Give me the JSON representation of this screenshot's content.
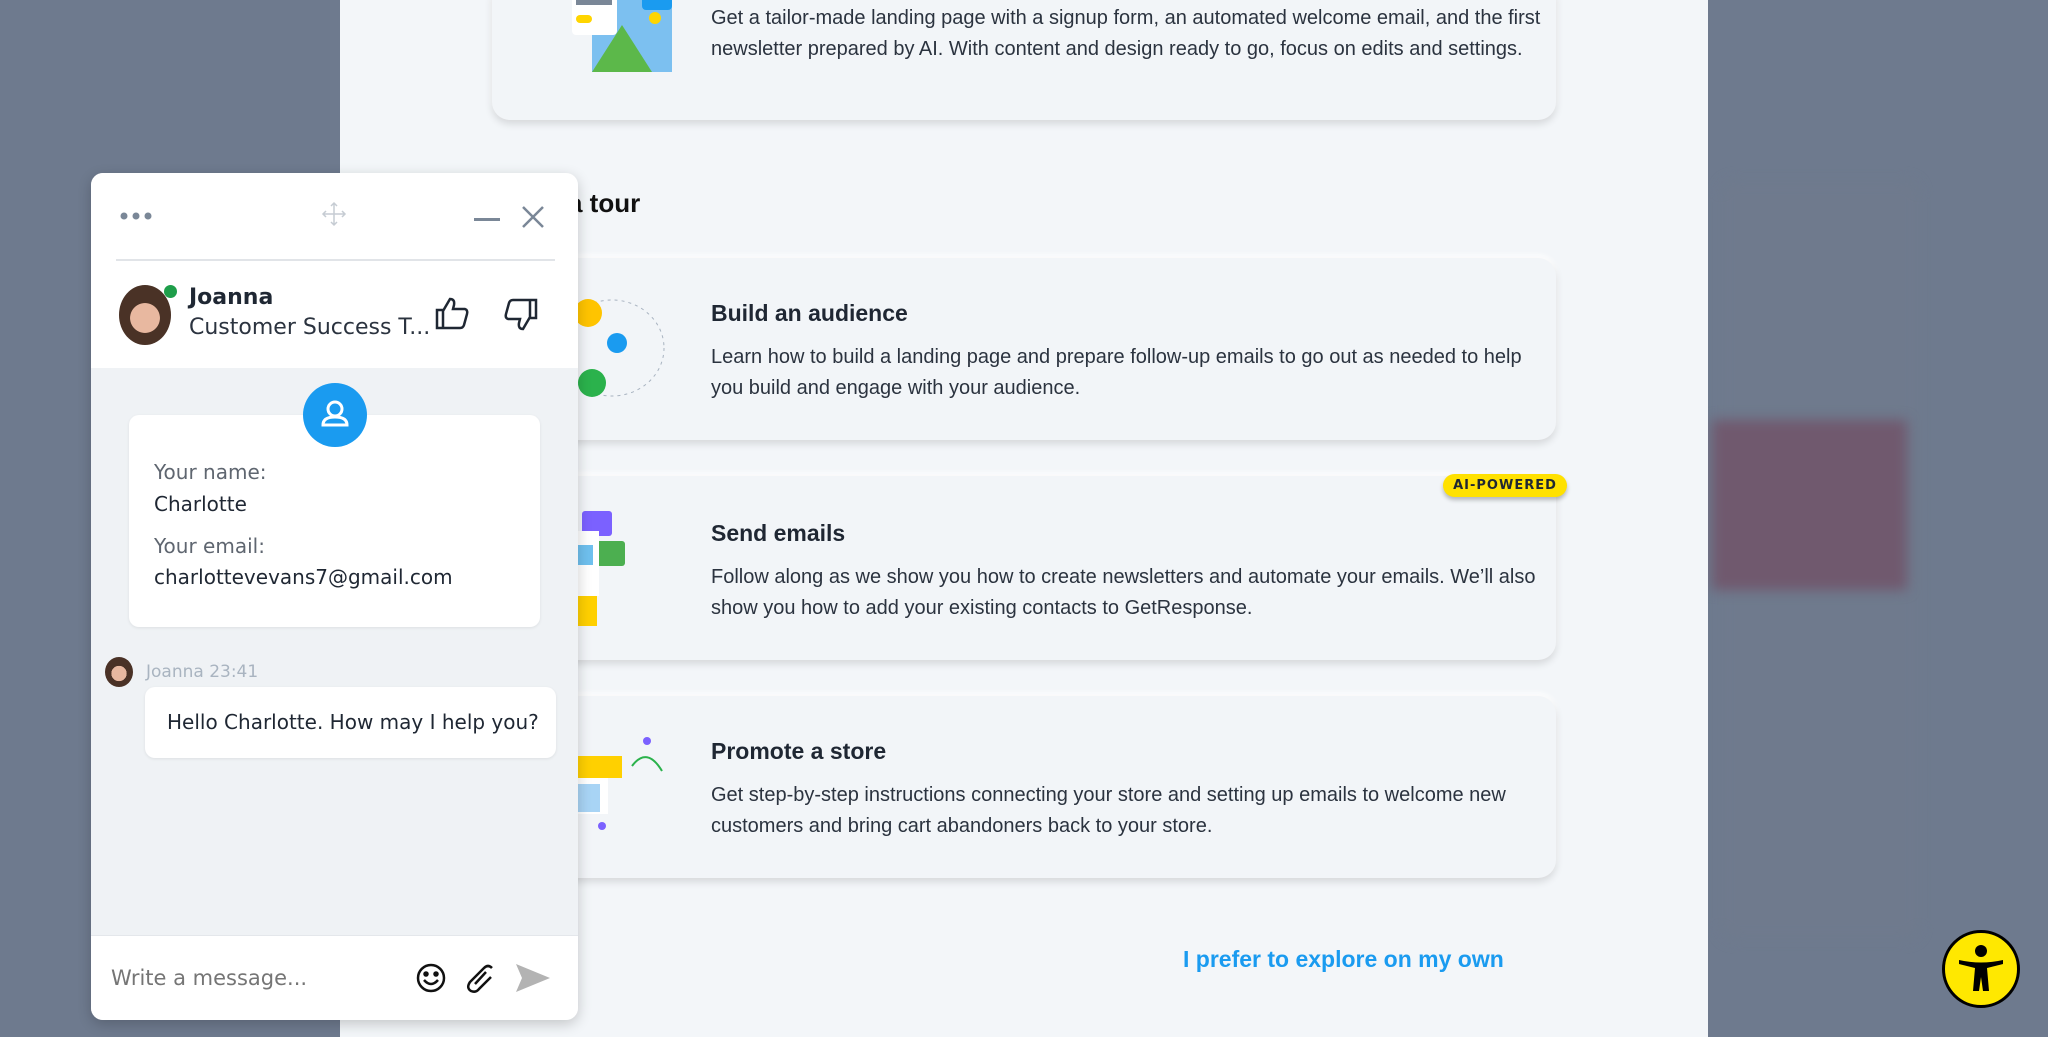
{
  "main": {
    "cards": [
      {
        "title": "",
        "description": "Get a tailor-made landing page with a signup form, an automated welcome email, and the first newsletter prepared by AI. With content and design ready to go, focus on edits and settings."
      },
      {
        "title": "Build an audience",
        "description": "Learn how to build a landing page and prepare follow-up emails to go out as needed to help you build and engage with your audience."
      },
      {
        "title": "Send emails",
        "description": "Follow along as we show you how to create newsletters and automate your emails. We’ll also show you how to add your existing contacts to GetResponse.",
        "badge": "AI-POWERED"
      },
      {
        "title": "Promote a store",
        "description": "Get step-by-step instructions connecting your store and setting up emails to welcome new customers and bring cart abandoners back to your store."
      }
    ],
    "section_heading": "a tour",
    "explore_link": "I prefer to explore on my own"
  },
  "chat": {
    "agent_name": "Joanna",
    "agent_title": "Customer Success T...",
    "status_color": "#1e9e4a",
    "form": {
      "name_label": "Your name:",
      "name_value": "Charlotte",
      "email_label": "Your email:",
      "email_value": "charlottevevans7@gmail.com"
    },
    "message_meta": "Joanna 23:41",
    "message_text": "Hello Charlotte. How may I help you?",
    "input_placeholder": "Write a message..."
  },
  "colors": {
    "accent": "#1a9bf0",
    "badge": "#ffe100",
    "overlay": "#6e7a8e"
  }
}
